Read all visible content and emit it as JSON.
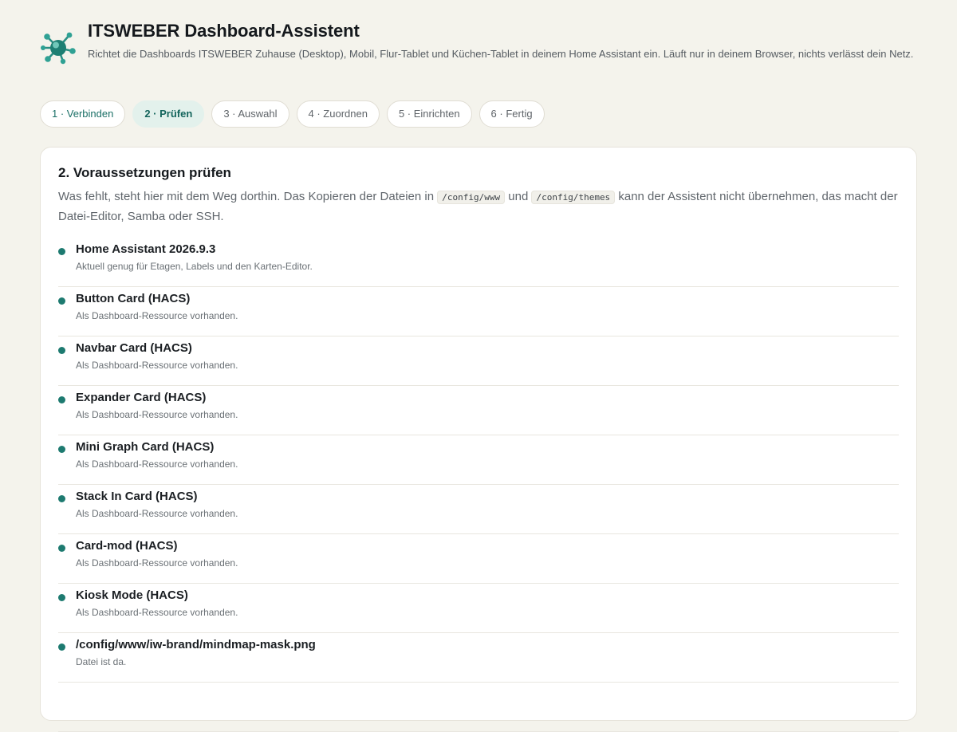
{
  "header": {
    "logo_icon": "mindmap-molecule-icon",
    "title": "ITSWEBER Dashboard-Assistent",
    "subtitle": "Richtet die Dashboards ITSWEBER Zuhause (Desktop), Mobil, Flur-Tablet und Küchen-Tablet in deinem Home Assistant ein. Läuft nur in deinem Browser, nichts verlässt dein Netz."
  },
  "steps": [
    {
      "label": "1 · Verbinden",
      "state": "done"
    },
    {
      "label": "2 · Prüfen",
      "state": "active"
    },
    {
      "label": "3 · Auswahl",
      "state": "pending"
    },
    {
      "label": "4 · Zuordnen",
      "state": "pending"
    },
    {
      "label": "5 · Einrichten",
      "state": "pending"
    },
    {
      "label": "6 · Fertig",
      "state": "pending"
    }
  ],
  "section": {
    "title": "2. Voraussetzungen prüfen",
    "desc_part1": "Was fehlt, steht hier mit dem Weg dorthin. Das Kopieren der Dateien in",
    "code1": "/config/www",
    "desc_part2": "und",
    "code2": "/config/themes",
    "desc_part3": "kann der Assistent nicht übernehmen, das macht der Datei-Editor, Samba oder SSH."
  },
  "checks": [
    {
      "title": "Home Assistant 2026.9.3",
      "note": "Aktuell genug für Etagen, Labels und den Karten-Editor."
    },
    {
      "title": "Button Card (HACS)",
      "note": "Als Dashboard-Ressource vorhanden."
    },
    {
      "title": "Navbar Card (HACS)",
      "note": "Als Dashboard-Ressource vorhanden."
    },
    {
      "title": "Expander Card (HACS)",
      "note": "Als Dashboard-Ressource vorhanden."
    },
    {
      "title": "Mini Graph Card (HACS)",
      "note": "Als Dashboard-Ressource vorhanden."
    },
    {
      "title": "Stack In Card (HACS)",
      "note": "Als Dashboard-Ressource vorhanden."
    },
    {
      "title": "Card-mod (HACS)",
      "note": "Als Dashboard-Ressource vorhanden."
    },
    {
      "title": "Kiosk Mode (HACS)",
      "note": "Als Dashboard-Ressource vorhanden."
    },
    {
      "title": "/config/www/iw-brand/mindmap-mask.png",
      "note": "Datei ist da."
    },
    {
      "title": "",
      "note": ""
    }
  ],
  "colors": {
    "accent": "#1d7a70",
    "page_background": "#f4f3ec",
    "active_step_background": "#e3f1ec"
  }
}
